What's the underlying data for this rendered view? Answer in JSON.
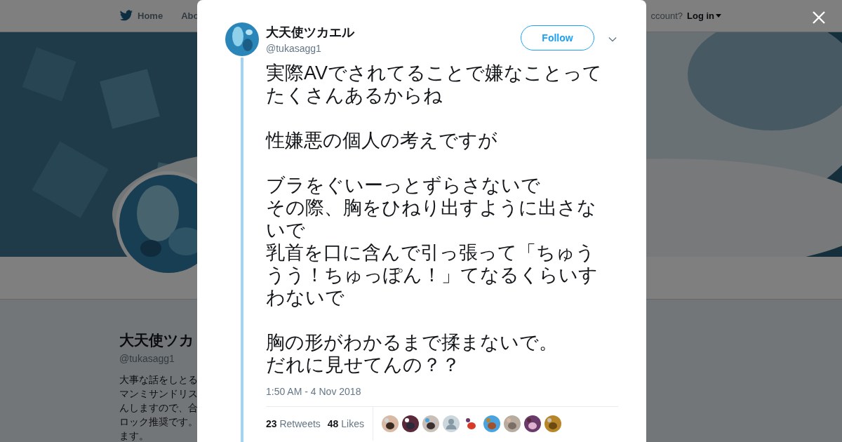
{
  "nav": {
    "items": [
      {
        "label": "Home",
        "kind": "home"
      },
      {
        "label": "Abo",
        "kind": "plain"
      }
    ],
    "account_prompt": "ccount?",
    "login": "Log in"
  },
  "profile": {
    "name": "大天使ツカ",
    "handle": "@tukasagg1",
    "bio": [
      "大事な話をしとる",
      "マンミサンドリス",
      "んしますので、合",
      "ロック推奨です。",
      "ます。"
    ]
  },
  "tweet": {
    "name": "大天使ツカエル",
    "handle": "@tukasagg1",
    "follow": "Follow",
    "paragraphs": [
      [
        "実際AVでされてることで嫌なことって",
        "たくさんあるからね"
      ],
      [
        "性嫌悪の個人の考えですが"
      ],
      [
        "ブラをぐいーっとずらさないで",
        "その際、胸をひねり出すように出さないで",
        "乳首を口に含んで引っ張って「ちゅううう！ちゅっぽん！」てなるくらいすわないで"
      ],
      [
        "胸の形がわかるまで揉まないで。",
        "だれに見せてんの？？"
      ]
    ],
    "time": "1:50 AM - 4 Nov 2018",
    "stats": [
      "**23** Retweets",
      "**48** Likes"
    ],
    "likers": [
      {
        "kind": "picture"
      },
      {
        "kind": "picture"
      },
      {
        "kind": "picture"
      },
      {
        "kind": "silhouette"
      },
      {
        "kind": "picture"
      },
      {
        "kind": "picture"
      },
      {
        "kind": "picture"
      },
      {
        "kind": "picture"
      },
      {
        "kind": "picture"
      }
    ]
  }
}
